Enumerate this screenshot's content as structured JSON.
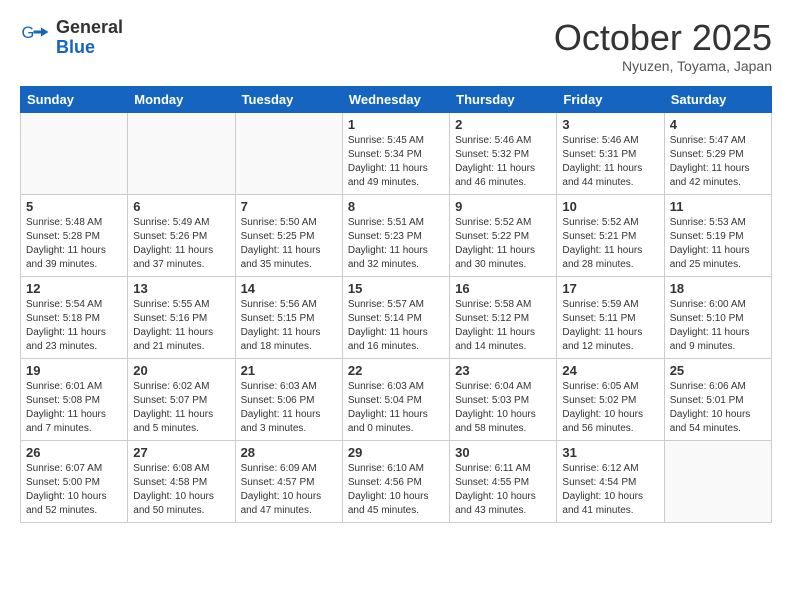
{
  "logo": {
    "general": "General",
    "blue": "Blue"
  },
  "header": {
    "month": "October 2025",
    "location": "Nyuzen, Toyama, Japan"
  },
  "weekdays": [
    "Sunday",
    "Monday",
    "Tuesday",
    "Wednesday",
    "Thursday",
    "Friday",
    "Saturday"
  ],
  "weeks": [
    [
      {
        "day": "",
        "info": ""
      },
      {
        "day": "",
        "info": ""
      },
      {
        "day": "",
        "info": ""
      },
      {
        "day": "1",
        "info": "Sunrise: 5:45 AM\nSunset: 5:34 PM\nDaylight: 11 hours\nand 49 minutes."
      },
      {
        "day": "2",
        "info": "Sunrise: 5:46 AM\nSunset: 5:32 PM\nDaylight: 11 hours\nand 46 minutes."
      },
      {
        "day": "3",
        "info": "Sunrise: 5:46 AM\nSunset: 5:31 PM\nDaylight: 11 hours\nand 44 minutes."
      },
      {
        "day": "4",
        "info": "Sunrise: 5:47 AM\nSunset: 5:29 PM\nDaylight: 11 hours\nand 42 minutes."
      }
    ],
    [
      {
        "day": "5",
        "info": "Sunrise: 5:48 AM\nSunset: 5:28 PM\nDaylight: 11 hours\nand 39 minutes."
      },
      {
        "day": "6",
        "info": "Sunrise: 5:49 AM\nSunset: 5:26 PM\nDaylight: 11 hours\nand 37 minutes."
      },
      {
        "day": "7",
        "info": "Sunrise: 5:50 AM\nSunset: 5:25 PM\nDaylight: 11 hours\nand 35 minutes."
      },
      {
        "day": "8",
        "info": "Sunrise: 5:51 AM\nSunset: 5:23 PM\nDaylight: 11 hours\nand 32 minutes."
      },
      {
        "day": "9",
        "info": "Sunrise: 5:52 AM\nSunset: 5:22 PM\nDaylight: 11 hours\nand 30 minutes."
      },
      {
        "day": "10",
        "info": "Sunrise: 5:52 AM\nSunset: 5:21 PM\nDaylight: 11 hours\nand 28 minutes."
      },
      {
        "day": "11",
        "info": "Sunrise: 5:53 AM\nSunset: 5:19 PM\nDaylight: 11 hours\nand 25 minutes."
      }
    ],
    [
      {
        "day": "12",
        "info": "Sunrise: 5:54 AM\nSunset: 5:18 PM\nDaylight: 11 hours\nand 23 minutes."
      },
      {
        "day": "13",
        "info": "Sunrise: 5:55 AM\nSunset: 5:16 PM\nDaylight: 11 hours\nand 21 minutes."
      },
      {
        "day": "14",
        "info": "Sunrise: 5:56 AM\nSunset: 5:15 PM\nDaylight: 11 hours\nand 18 minutes."
      },
      {
        "day": "15",
        "info": "Sunrise: 5:57 AM\nSunset: 5:14 PM\nDaylight: 11 hours\nand 16 minutes."
      },
      {
        "day": "16",
        "info": "Sunrise: 5:58 AM\nSunset: 5:12 PM\nDaylight: 11 hours\nand 14 minutes."
      },
      {
        "day": "17",
        "info": "Sunrise: 5:59 AM\nSunset: 5:11 PM\nDaylight: 11 hours\nand 12 minutes."
      },
      {
        "day": "18",
        "info": "Sunrise: 6:00 AM\nSunset: 5:10 PM\nDaylight: 11 hours\nand 9 minutes."
      }
    ],
    [
      {
        "day": "19",
        "info": "Sunrise: 6:01 AM\nSunset: 5:08 PM\nDaylight: 11 hours\nand 7 minutes."
      },
      {
        "day": "20",
        "info": "Sunrise: 6:02 AM\nSunset: 5:07 PM\nDaylight: 11 hours\nand 5 minutes."
      },
      {
        "day": "21",
        "info": "Sunrise: 6:03 AM\nSunset: 5:06 PM\nDaylight: 11 hours\nand 3 minutes."
      },
      {
        "day": "22",
        "info": "Sunrise: 6:03 AM\nSunset: 5:04 PM\nDaylight: 11 hours\nand 0 minutes."
      },
      {
        "day": "23",
        "info": "Sunrise: 6:04 AM\nSunset: 5:03 PM\nDaylight: 10 hours\nand 58 minutes."
      },
      {
        "day": "24",
        "info": "Sunrise: 6:05 AM\nSunset: 5:02 PM\nDaylight: 10 hours\nand 56 minutes."
      },
      {
        "day": "25",
        "info": "Sunrise: 6:06 AM\nSunset: 5:01 PM\nDaylight: 10 hours\nand 54 minutes."
      }
    ],
    [
      {
        "day": "26",
        "info": "Sunrise: 6:07 AM\nSunset: 5:00 PM\nDaylight: 10 hours\nand 52 minutes."
      },
      {
        "day": "27",
        "info": "Sunrise: 6:08 AM\nSunset: 4:58 PM\nDaylight: 10 hours\nand 50 minutes."
      },
      {
        "day": "28",
        "info": "Sunrise: 6:09 AM\nSunset: 4:57 PM\nDaylight: 10 hours\nand 47 minutes."
      },
      {
        "day": "29",
        "info": "Sunrise: 6:10 AM\nSunset: 4:56 PM\nDaylight: 10 hours\nand 45 minutes."
      },
      {
        "day": "30",
        "info": "Sunrise: 6:11 AM\nSunset: 4:55 PM\nDaylight: 10 hours\nand 43 minutes."
      },
      {
        "day": "31",
        "info": "Sunrise: 6:12 AM\nSunset: 4:54 PM\nDaylight: 10 hours\nand 41 minutes."
      },
      {
        "day": "",
        "info": ""
      }
    ]
  ]
}
